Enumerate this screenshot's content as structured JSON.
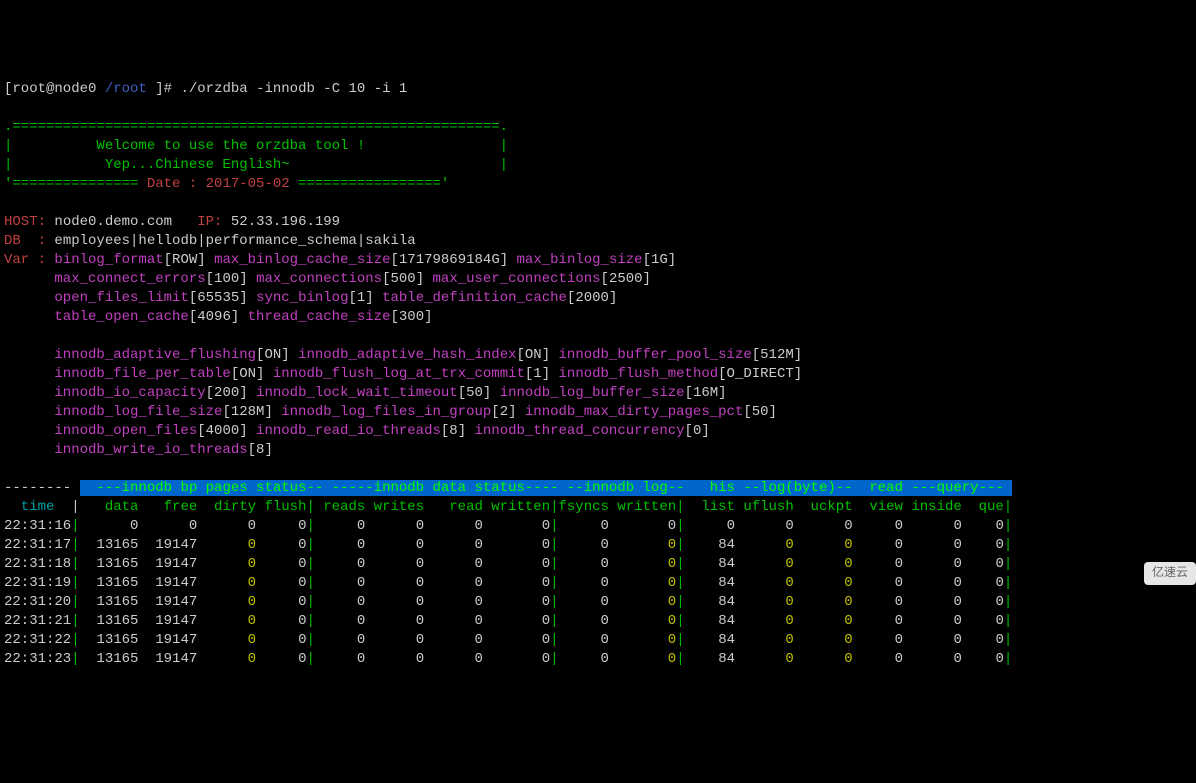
{
  "prompt": {
    "user_host": "[root@node0 ",
    "path": "/root ",
    "bracket": "]# ",
    "command": "./orzdba -innodb -C 10 -i 1"
  },
  "banner": {
    "top": ".==========================================================.",
    "line1": "|          Welcome to use the orzdba tool !                |",
    "line2": "|           Yep...Chinese English~                         |",
    "bottom_prefix": "'=============== ",
    "date_label": "Date : 2017-05-02",
    "bottom_suffix": " =================' "
  },
  "info": {
    "host_label": "HOST:",
    "host": " node0.demo.com",
    "ip_label": "   IP:",
    "ip": " 52.33.196.199",
    "db_label": "DB  :",
    "db": " employees|hellodb|performance_schema|sakila",
    "var_label": "Var :"
  },
  "vars": [
    {
      "name": " binlog_format",
      "val": "[ROW] "
    },
    {
      "name": "max_binlog_cache_size",
      "val": "[17179869184G] "
    },
    {
      "name": "max_binlog_size",
      "val": "[1G] "
    },
    {
      "name": "",
      "val": ""
    },
    {
      "name": "      max_connect_errors",
      "val": "[100] "
    },
    {
      "name": "max_connections",
      "val": "[500] "
    },
    {
      "name": "max_user_connections",
      "val": "[2500] "
    },
    {
      "name": "",
      "val": ""
    },
    {
      "name": "      open_files_limit",
      "val": "[65535] "
    },
    {
      "name": "sync_binlog",
      "val": "[1] "
    },
    {
      "name": "table_definition_cache",
      "val": "[2000] "
    },
    {
      "name": "",
      "val": ""
    },
    {
      "name": "      table_open_cache",
      "val": "[4096] "
    },
    {
      "name": "thread_cache_size",
      "val": "[300] "
    },
    {
      "name": "",
      "val": ""
    },
    {
      "name": "",
      "val": ""
    },
    {
      "name": "      innodb_adaptive_flushing",
      "val": "[ON] "
    },
    {
      "name": "innodb_adaptive_hash_index",
      "val": "[ON] "
    },
    {
      "name": "innodb_buffer_pool_size",
      "val": "[512M] "
    },
    {
      "name": "",
      "val": ""
    },
    {
      "name": "      innodb_file_per_table",
      "val": "[ON] "
    },
    {
      "name": "innodb_flush_log_at_trx_commit",
      "val": "[1] "
    },
    {
      "name": "innodb_flush_method",
      "val": "[O_DIRECT] "
    },
    {
      "name": "",
      "val": ""
    },
    {
      "name": "      innodb_io_capacity",
      "val": "[200] "
    },
    {
      "name": "innodb_lock_wait_timeout",
      "val": "[50] "
    },
    {
      "name": "innodb_log_buffer_size",
      "val": "[16M] "
    },
    {
      "name": "",
      "val": ""
    },
    {
      "name": "      innodb_log_file_size",
      "val": "[128M] "
    },
    {
      "name": "innodb_log_files_in_group",
      "val": "[2] "
    },
    {
      "name": "innodb_max_dirty_pages_pct",
      "val": "[50] "
    },
    {
      "name": "",
      "val": ""
    },
    {
      "name": "      innodb_open_files",
      "val": "[4000] "
    },
    {
      "name": "innodb_read_io_threads",
      "val": "[8] "
    },
    {
      "name": "innodb_thread_concurrency",
      "val": "[0] "
    },
    {
      "name": "",
      "val": ""
    },
    {
      "name": "      innodb_write_io_threads",
      "val": "[8] "
    }
  ],
  "header": {
    "dashes": "-------- ",
    "groups": "  ---innodb bp pages status-- -----innodb data status---- --innodb log--   his --log(byte)--  read ---query--- ",
    "time_label": "  time  ",
    "pipe": "|",
    "cols": "   data   free  dirty flush| reads writes   read written|fsyncs written|  list uflush  uckpt  view inside  que|"
  },
  "chart_data": {
    "type": "table",
    "columns": [
      "time",
      "data",
      "free",
      "dirty",
      "flush",
      "reads",
      "writes",
      "read",
      "written",
      "fsyncs",
      "written2",
      "list",
      "uflush",
      "uckpt",
      "view",
      "inside",
      "que"
    ],
    "rows": [
      {
        "time": "22:31:16",
        "data": 0,
        "free": 0,
        "dirty": 0,
        "flush": 0,
        "reads": 0,
        "writes": 0,
        "read": 0,
        "written": 0,
        "fsyncs": 0,
        "written2": 0,
        "list": 0,
        "uflush": 0,
        "uckpt": 0,
        "view": 0,
        "inside": 0,
        "que": 0
      },
      {
        "time": "22:31:17",
        "data": 13165,
        "free": 19147,
        "dirty": 0,
        "flush": 0,
        "reads": 0,
        "writes": 0,
        "read": 0,
        "written": 0,
        "fsyncs": 0,
        "written2": 0,
        "list": 84,
        "uflush": 0,
        "uckpt": 0,
        "view": 0,
        "inside": 0,
        "que": 0
      },
      {
        "time": "22:31:18",
        "data": 13165,
        "free": 19147,
        "dirty": 0,
        "flush": 0,
        "reads": 0,
        "writes": 0,
        "read": 0,
        "written": 0,
        "fsyncs": 0,
        "written2": 0,
        "list": 84,
        "uflush": 0,
        "uckpt": 0,
        "view": 0,
        "inside": 0,
        "que": 0
      },
      {
        "time": "22:31:19",
        "data": 13165,
        "free": 19147,
        "dirty": 0,
        "flush": 0,
        "reads": 0,
        "writes": 0,
        "read": 0,
        "written": 0,
        "fsyncs": 0,
        "written2": 0,
        "list": 84,
        "uflush": 0,
        "uckpt": 0,
        "view": 0,
        "inside": 0,
        "que": 0
      },
      {
        "time": "22:31:20",
        "data": 13165,
        "free": 19147,
        "dirty": 0,
        "flush": 0,
        "reads": 0,
        "writes": 0,
        "read": 0,
        "written": 0,
        "fsyncs": 0,
        "written2": 0,
        "list": 84,
        "uflush": 0,
        "uckpt": 0,
        "view": 0,
        "inside": 0,
        "que": 0
      },
      {
        "time": "22:31:21",
        "data": 13165,
        "free": 19147,
        "dirty": 0,
        "flush": 0,
        "reads": 0,
        "writes": 0,
        "read": 0,
        "written": 0,
        "fsyncs": 0,
        "written2": 0,
        "list": 84,
        "uflush": 0,
        "uckpt": 0,
        "view": 0,
        "inside": 0,
        "que": 0
      },
      {
        "time": "22:31:22",
        "data": 13165,
        "free": 19147,
        "dirty": 0,
        "flush": 0,
        "reads": 0,
        "writes": 0,
        "read": 0,
        "written": 0,
        "fsyncs": 0,
        "written2": 0,
        "list": 84,
        "uflush": 0,
        "uckpt": 0,
        "view": 0,
        "inside": 0,
        "que": 0
      },
      {
        "time": "22:31:23",
        "data": 13165,
        "free": 19147,
        "dirty": 0,
        "flush": 0,
        "reads": 0,
        "writes": 0,
        "read": 0,
        "written": 0,
        "fsyncs": 0,
        "written2": 0,
        "list": 84,
        "uflush": 0,
        "uckpt": 0,
        "view": 0,
        "inside": 0,
        "que": 0
      }
    ]
  },
  "watermark": "亿速云"
}
